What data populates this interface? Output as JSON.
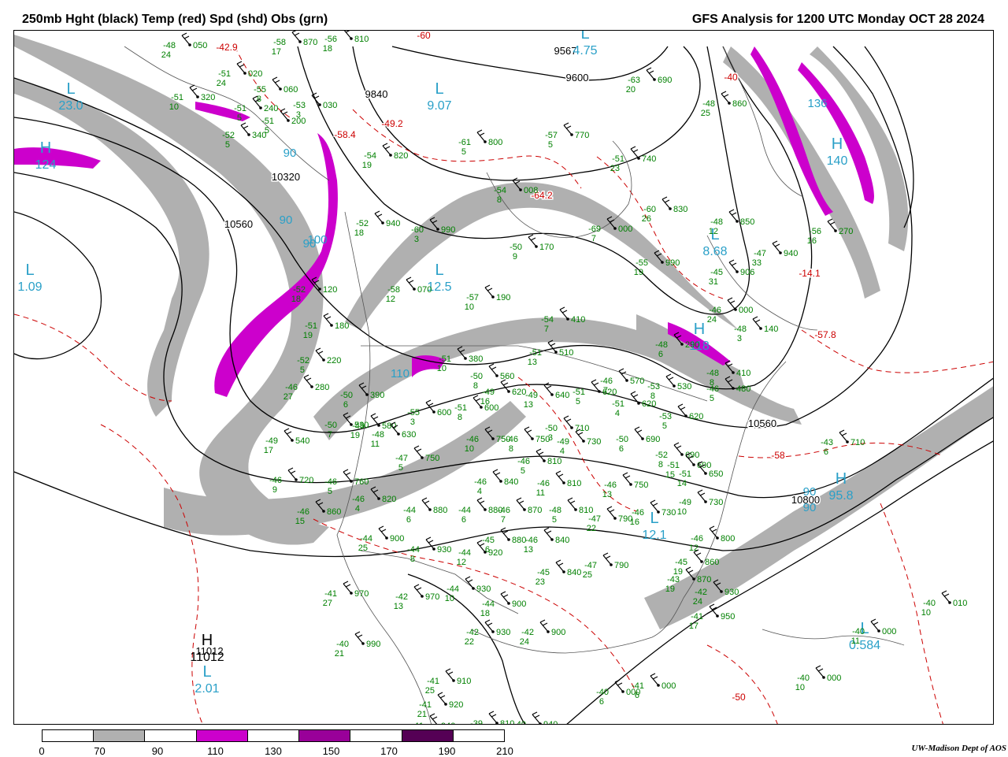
{
  "header": {
    "left_title": "250mb Hght (black) Temp (red) Spd (shd) Obs (grn)",
    "right_title": "GFS Analysis for 1200 UTC Monday  OCT 28 2024"
  },
  "colors": {
    "height_contour": "#000000",
    "temperature_contour": "#cc0000",
    "observation_text": "#008000",
    "speed_label": "#2aa0c8",
    "coastline": "#555555",
    "shade_70_90": "#b0b0b0",
    "shade_110_130": "#cc00cc",
    "shade_150_170": "#990099",
    "shade_190_210": "#550055"
  },
  "legend": {
    "labels": [
      "0",
      "70",
      "90",
      "110",
      "130",
      "150",
      "170",
      "190",
      "210"
    ],
    "swatch_colors": [
      "#ffffff",
      "#b0b0b0",
      "#ffffff",
      "#cc00cc",
      "#ffffff",
      "#990099",
      "#ffffff",
      "#550055",
      "#ffffff"
    ]
  },
  "height_labels": [
    "9840",
    "9600",
    "9567",
    "10320",
    "10560",
    "10560",
    "10800",
    "11012"
  ],
  "temperature_labels": [
    "-42.9",
    "-60",
    "-58.4",
    "-49.2",
    "-64.2",
    "-57.8",
    "-58",
    "-50",
    "-40",
    "-14.1"
  ],
  "pressure_centers": [
    {
      "type": "L",
      "value": "23.0"
    },
    {
      "type": "H",
      "value": "124"
    },
    {
      "type": "L",
      "value": "1.09"
    },
    {
      "type": "L",
      "value": "9.07"
    },
    {
      "type": "L",
      "value": "4.75"
    },
    {
      "type": "L",
      "value": "12.5"
    },
    {
      "type": "H",
      "value": "118"
    },
    {
      "type": "H",
      "value": "140"
    },
    {
      "type": "L",
      "value": "8.68"
    },
    {
      "type": "H",
      "value": "95.8"
    },
    {
      "type": "L",
      "value": "12.1"
    },
    {
      "type": "H",
      "value": "11012"
    },
    {
      "type": "L",
      "value": "2.01"
    },
    {
      "type": "L",
      "value": "0.584"
    }
  ],
  "speed_labels": [
    "90",
    "90",
    "90",
    "100",
    "110",
    "136",
    "90",
    "90"
  ],
  "observations": [
    {
      "temp": "-48",
      "hgt": "050",
      "dew": "24"
    },
    {
      "temp": "-58",
      "hgt": "870",
      "dew": "17"
    },
    {
      "temp": "-56",
      "hgt": "810",
      "dew": "18"
    },
    {
      "temp": "-51",
      "hgt": "020",
      "dew": "24"
    },
    {
      "temp": "-55",
      "hgt": "060",
      "dew": "8"
    },
    {
      "temp": "-53",
      "hgt": "030",
      "dew": "3"
    },
    {
      "temp": "-51",
      "hgt": "200",
      "dew": "5"
    },
    {
      "temp": "-52",
      "hgt": "340",
      "dew": "5"
    },
    {
      "temp": "-51",
      "hgt": "320",
      "dew": "10"
    },
    {
      "temp": "-51",
      "hgt": "240",
      "dew": "5"
    },
    {
      "temp": "-54",
      "hgt": "820",
      "dew": "19"
    },
    {
      "temp": "-52",
      "hgt": "940",
      "dew": "18"
    },
    {
      "temp": "-60",
      "hgt": "990",
      "dew": "3"
    },
    {
      "temp": "-61",
      "hgt": "800",
      "dew": "5"
    },
    {
      "temp": "-63",
      "hgt": "690",
      "dew": "20"
    },
    {
      "temp": "-57",
      "hgt": "770",
      "dew": "5"
    },
    {
      "temp": "-51",
      "hgt": "740",
      "dew": "23"
    },
    {
      "temp": "-60",
      "hgt": "830",
      "dew": "26"
    },
    {
      "temp": "-48",
      "hgt": "850",
      "dew": "12"
    },
    {
      "temp": "-48",
      "hgt": "860",
      "dew": "25"
    },
    {
      "temp": "-54",
      "hgt": "008",
      "dew": "8"
    },
    {
      "temp": "-69",
      "hgt": "000",
      "dew": "7"
    },
    {
      "temp": "-50",
      "hgt": "170",
      "dew": "9"
    },
    {
      "temp": "-55",
      "hgt": "990",
      "dew": "19"
    },
    {
      "temp": "-56",
      "hgt": "270",
      "dew": "16"
    },
    {
      "temp": "-47",
      "hgt": "940",
      "dew": "33"
    },
    {
      "temp": "-45",
      "hgt": "906",
      "dew": "31"
    },
    {
      "temp": "-58",
      "hgt": "070",
      "dew": "12"
    },
    {
      "temp": "-57",
      "hgt": "190",
      "dew": "10"
    },
    {
      "temp": "-52",
      "hgt": "120",
      "dew": "18"
    },
    {
      "temp": "-51",
      "hgt": "180",
      "dew": "19"
    },
    {
      "temp": "-52",
      "hgt": "220",
      "dew": "5"
    },
    {
      "temp": "-54",
      "hgt": "410",
      "dew": "7"
    },
    {
      "temp": "-46",
      "hgt": "000",
      "dew": "24"
    },
    {
      "temp": "-48",
      "hgt": "140",
      "dew": "3"
    },
    {
      "temp": "-48",
      "hgt": "290",
      "dew": "6"
    },
    {
      "temp": "-51",
      "hgt": "510",
      "dew": "13"
    },
    {
      "temp": "-51",
      "hgt": "380",
      "dew": "10"
    },
    {
      "temp": "-46",
      "hgt": "280",
      "dew": "27"
    },
    {
      "temp": "-50",
      "hgt": "390",
      "dew": "6"
    },
    {
      "temp": "-50",
      "hgt": "560",
      "dew": "8"
    },
    {
      "temp": "-49",
      "hgt": "620",
      "dew": "16"
    },
    {
      "temp": "-49",
      "hgt": "640",
      "dew": "13"
    },
    {
      "temp": "-51",
      "hgt": "620",
      "dew": "5"
    },
    {
      "temp": "-46",
      "hgt": "570",
      "dew": "7"
    },
    {
      "temp": "-53",
      "hgt": "530",
      "dew": "8"
    },
    {
      "temp": "-48",
      "hgt": "410",
      "dew": "8"
    },
    {
      "temp": "-46",
      "hgt": "480",
      "dew": "5"
    },
    {
      "temp": "-51",
      "hgt": "620",
      "dew": "4"
    },
    {
      "temp": "-53",
      "hgt": "620",
      "dew": "5"
    },
    {
      "temp": "-55",
      "hgt": "600",
      "dew": "3"
    },
    {
      "temp": "-51",
      "hgt": "600",
      "dew": "8"
    },
    {
      "temp": "-49",
      "hgt": "580",
      "dew": "19"
    },
    {
      "temp": "-50",
      "hgt": "530",
      "dew": "7"
    },
    {
      "temp": "-48",
      "hgt": "630",
      "dew": "11"
    },
    {
      "temp": "-49",
      "hgt": "540",
      "dew": "17"
    },
    {
      "temp": "-47",
      "hgt": "750",
      "dew": "5"
    },
    {
      "temp": "-46",
      "hgt": "750",
      "dew": "10"
    },
    {
      "temp": "-46",
      "hgt": "750",
      "dew": "8"
    },
    {
      "temp": "-50",
      "hgt": "710",
      "dew": "3"
    },
    {
      "temp": "-49",
      "hgt": "730",
      "dew": "4"
    },
    {
      "temp": "-50",
      "hgt": "690",
      "dew": "6"
    },
    {
      "temp": "-52",
      "hgt": "690",
      "dew": "8"
    },
    {
      "temp": "-51",
      "hgt": "690",
      "dew": "15"
    },
    {
      "temp": "-51",
      "hgt": "650",
      "dew": "14"
    },
    {
      "temp": "-46",
      "hgt": "720",
      "dew": "9"
    },
    {
      "temp": "-46",
      "hgt": "760",
      "dew": "5"
    },
    {
      "temp": "-46",
      "hgt": "820",
      "dew": "4"
    },
    {
      "temp": "-46",
      "hgt": "810",
      "dew": "5"
    },
    {
      "temp": "-46",
      "hgt": "840",
      "dew": "4"
    },
    {
      "temp": "-46",
      "hgt": "810",
      "dew": "11"
    },
    {
      "temp": "-46",
      "hgt": "750",
      "dew": "13"
    },
    {
      "temp": "-46",
      "hgt": "860",
      "dew": "15"
    },
    {
      "temp": "-44",
      "hgt": "880",
      "dew": "6"
    },
    {
      "temp": "-44",
      "hgt": "880",
      "dew": "6"
    },
    {
      "temp": "-46",
      "hgt": "870",
      "dew": "7"
    },
    {
      "temp": "-48",
      "hgt": "810",
      "dew": "5"
    },
    {
      "temp": "-47",
      "hgt": "790",
      "dew": "22"
    },
    {
      "temp": "-46",
      "hgt": "730",
      "dew": "16"
    },
    {
      "temp": "-49",
      "hgt": "730",
      "dew": "10"
    },
    {
      "temp": "-44",
      "hgt": "900",
      "dew": "25"
    },
    {
      "temp": "-44",
      "hgt": "930",
      "dew": "8"
    },
    {
      "temp": "-44",
      "hgt": "920",
      "dew": "12"
    },
    {
      "temp": "-45",
      "hgt": "880",
      "dew": "6"
    },
    {
      "temp": "-46",
      "hgt": "840",
      "dew": "13"
    },
    {
      "temp": "-45",
      "hgt": "840",
      "dew": "23"
    },
    {
      "temp": "-47",
      "hgt": "790",
      "dew": "25"
    },
    {
      "temp": "-46",
      "hgt": "800",
      "dew": "12"
    },
    {
      "temp": "-45",
      "hgt": "860",
      "dew": "19"
    },
    {
      "temp": "-43",
      "hgt": "870",
      "dew": "19"
    },
    {
      "temp": "-42",
      "hgt": "930",
      "dew": "24"
    },
    {
      "temp": "-41",
      "hgt": "970",
      "dew": "27"
    },
    {
      "temp": "-42",
      "hgt": "970",
      "dew": "13"
    },
    {
      "temp": "-44",
      "hgt": "930",
      "dew": "10"
    },
    {
      "temp": "-44",
      "hgt": "900",
      "dew": "18"
    },
    {
      "temp": "-42",
      "hgt": "930",
      "dew": "22"
    },
    {
      "temp": "-42",
      "hgt": "900",
      "dew": "24"
    },
    {
      "temp": "-41",
      "hgt": "950",
      "dew": "17"
    },
    {
      "temp": "-40",
      "hgt": "990",
      "dew": "21"
    },
    {
      "temp": "-41",
      "hgt": "910",
      "dew": "25"
    },
    {
      "temp": "-41",
      "hgt": "920",
      "dew": "21"
    },
    {
      "temp": "-41",
      "hgt": "940",
      "dew": "21"
    },
    {
      "temp": "-39",
      "hgt": "810",
      "dew": "21"
    },
    {
      "temp": "-40",
      "hgt": "940",
      "dew": "21"
    },
    {
      "temp": "-40",
      "hgt": "000",
      "dew": "6"
    },
    {
      "temp": "-41",
      "hgt": "000",
      "dew": "6"
    },
    {
      "temp": "-40",
      "hgt": "000",
      "dew": "10"
    },
    {
      "temp": "-40",
      "hgt": "010",
      "dew": "10"
    },
    {
      "temp": "-40",
      "hgt": "000",
      "dew": "11"
    },
    {
      "temp": "-43",
      "hgt": "710",
      "dew": "6"
    }
  ],
  "credit": "UW-Madison  Dept of AOS"
}
